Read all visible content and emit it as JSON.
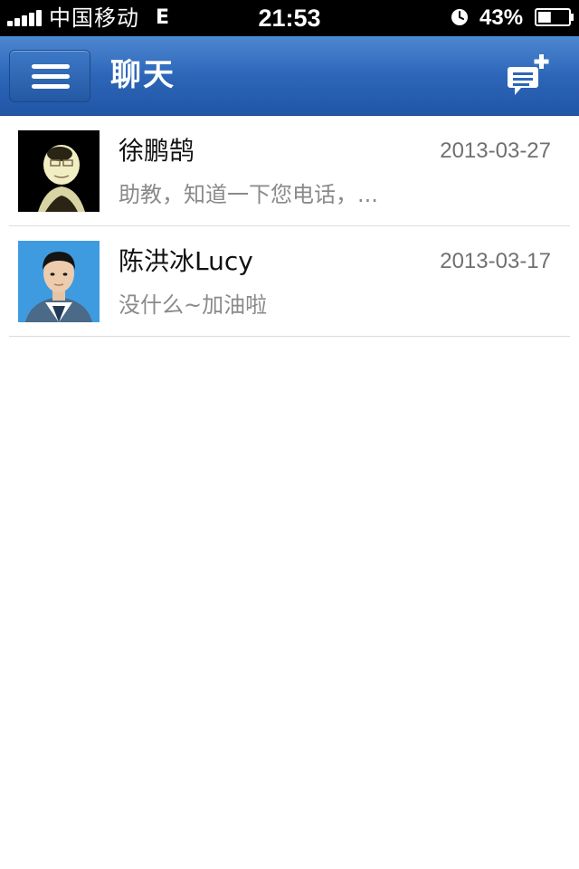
{
  "status_bar": {
    "carrier": "中国移动",
    "network": "E",
    "time": "21:53",
    "battery_percent": "43%",
    "battery_level": 0.43,
    "signal_icon": "signal-bars-icon",
    "alarm_icon": "alarm-clock-icon",
    "battery_icon": "battery-icon"
  },
  "nav": {
    "title": "聊天",
    "menu_icon": "hamburger-menu-icon",
    "new_chat_icon": "new-chat-plus-icon",
    "accent_color": "#2d66b8"
  },
  "chats": [
    {
      "name": "徐鹏鹄",
      "date": "2013-03-27",
      "preview": "助教，知道一下您电话，...",
      "avatar": "avatar-photo-icon"
    },
    {
      "name": "陈洪冰Lucy",
      "date": "2013-03-17",
      "preview": "没什么~加油啦",
      "avatar": "avatar-photo-icon"
    }
  ]
}
